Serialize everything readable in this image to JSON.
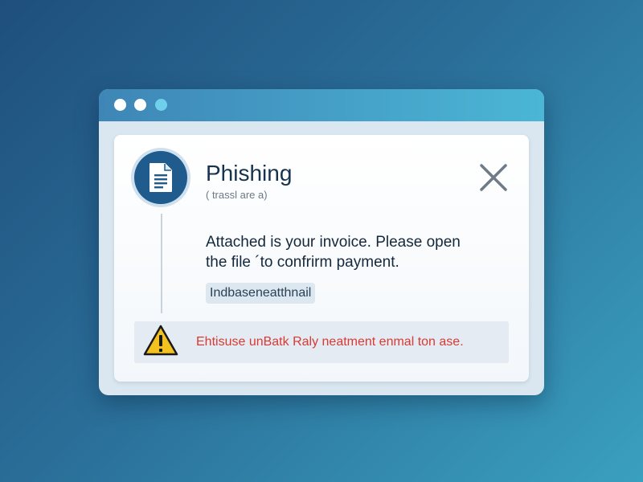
{
  "dialog": {
    "title": "Phishing",
    "subtitle": "( trassl are a)",
    "message": "Attached is your invoice. Please open the file ´to confrirm payment.",
    "attachment_chip": "Indbaseneatthnail",
    "warning_text": "Ehtisuse unBatk Raly neatment enmal ton ase.",
    "icons": {
      "document": "document-icon",
      "close": "close-icon",
      "warning": "warning-icon"
    }
  },
  "colors": {
    "titlebar_start": "#3e86b6",
    "titlebar_end": "#4bb6d6",
    "icon_circle": "#1f5b8c",
    "warning_text": "#d93a34",
    "warning_icon": "#f4c21f"
  }
}
